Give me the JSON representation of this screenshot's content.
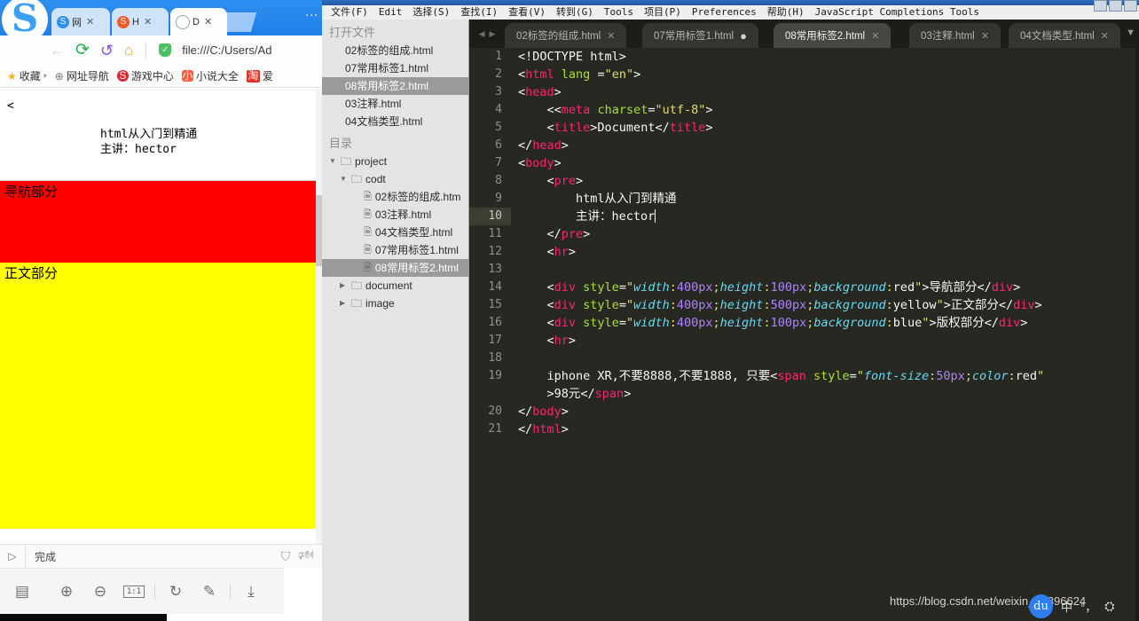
{
  "browser": {
    "logo": "S",
    "tabs": [
      {
        "label": "网",
        "favicon": "sogou-icon",
        "close": "✕",
        "active": false
      },
      {
        "label": "H",
        "favicon": "sogou-orange-icon",
        "close": "✕",
        "active": false
      },
      {
        "label": "D",
        "favicon": "document-icon",
        "close": "✕",
        "active": true
      }
    ],
    "nav": {
      "back": "←",
      "reload": "⟳",
      "undo": "↺",
      "home": "⌂",
      "shield": "✓",
      "url": "file:///C:/Users/Ad"
    },
    "bookmarks": [
      {
        "label": "收藏",
        "icon": "star-icon",
        "caret": "▾"
      },
      {
        "label": "网址导航",
        "icon": "globe-icon"
      },
      {
        "label": "游戏中心",
        "icon": "sogou-game-icon"
      },
      {
        "label": "小说大全",
        "icon": "novel-icon"
      },
      {
        "label": "爱",
        "icon": "taobao-icon"
      }
    ],
    "page": {
      "stray_text": "<",
      "pre_line1": "html从入门到精通",
      "pre_line2": "主讲：hector",
      "nav_section": "导航部分",
      "body_section": "正文部分"
    },
    "status": {
      "play": "▷",
      "text": "完成",
      "shield_icon": "shield-check-icon",
      "sound_icon": "speaker-icon"
    },
    "toolbar": {
      "layout": "▤",
      "zoom_in": "⊕",
      "zoom_out": "⊖",
      "ratio": "1:1",
      "rotate": "↻",
      "pen": "✎",
      "download": "⤓"
    }
  },
  "editor": {
    "menubar": [
      "文件(F)",
      "Edit",
      "选择(S)",
      "查找(I)",
      "查看(V)",
      "转到(G)",
      "Tools",
      "项目(P)",
      "Preferences",
      "帮助(H)",
      "JavaScript Completions Tools"
    ],
    "tabs": [
      {
        "label": "02标签的组成.html",
        "marker": "✕",
        "active": false
      },
      {
        "label": "07常用标签1.html",
        "marker": "●",
        "active": false
      },
      {
        "label": "08常用标签2.html",
        "marker": "✕",
        "active": true
      },
      {
        "label": "03注释.html",
        "marker": "✕",
        "active": false
      },
      {
        "label": "04文档类型.html",
        "marker": "✕",
        "active": false
      }
    ],
    "tab_arrow_left": "◀",
    "tab_arrow_right": "▶",
    "tab_menu": "▼",
    "current_line": 10,
    "lines": [
      {
        "n": "1",
        "tokens": [
          {
            "t": "punc",
            "v": "<!DOCTYPE html>"
          }
        ]
      },
      {
        "n": "2",
        "tokens": [
          {
            "t": "punc",
            "v": "<"
          },
          {
            "t": "tag",
            "v": "html"
          },
          {
            "t": "punc",
            "v": " "
          },
          {
            "t": "attr",
            "v": "lang"
          },
          {
            "t": "punc",
            "v": " ="
          },
          {
            "t": "str",
            "v": "\"en\""
          },
          {
            "t": "punc",
            "v": ">"
          }
        ]
      },
      {
        "n": "3",
        "tokens": [
          {
            "t": "punc",
            "v": "<"
          },
          {
            "t": "tag",
            "v": "head"
          },
          {
            "t": "punc",
            "v": ">"
          }
        ]
      },
      {
        "n": "4",
        "tokens": [
          {
            "t": "punc",
            "v": "    <<"
          },
          {
            "t": "tag",
            "v": "meta"
          },
          {
            "t": "punc",
            "v": " "
          },
          {
            "t": "attr",
            "v": "charset"
          },
          {
            "t": "punc",
            "v": "="
          },
          {
            "t": "str",
            "v": "\"utf-8\""
          },
          {
            "t": "punc",
            "v": ">"
          }
        ]
      },
      {
        "n": "5",
        "tokens": [
          {
            "t": "punc",
            "v": "    <"
          },
          {
            "t": "tag",
            "v": "title"
          },
          {
            "t": "punc",
            "v": ">"
          },
          {
            "t": "txt",
            "v": "Document"
          },
          {
            "t": "punc",
            "v": "</"
          },
          {
            "t": "tag",
            "v": "title"
          },
          {
            "t": "punc",
            "v": ">"
          }
        ]
      },
      {
        "n": "6",
        "tokens": [
          {
            "t": "punc",
            "v": "</"
          },
          {
            "t": "tag",
            "v": "head"
          },
          {
            "t": "punc",
            "v": ">"
          }
        ]
      },
      {
        "n": "7",
        "tokens": [
          {
            "t": "punc",
            "v": "<"
          },
          {
            "t": "tag",
            "v": "body"
          },
          {
            "t": "punc",
            "v": ">"
          }
        ]
      },
      {
        "n": "8",
        "tokens": [
          {
            "t": "punc",
            "v": "    <"
          },
          {
            "t": "tag",
            "v": "pre"
          },
          {
            "t": "punc",
            "v": ">"
          }
        ]
      },
      {
        "n": "9",
        "tokens": [
          {
            "t": "txt",
            "v": "        html从入门到精通"
          }
        ]
      },
      {
        "n": "10",
        "tokens": [
          {
            "t": "txt",
            "v": "        主讲：hector"
          }
        ],
        "caret": true
      },
      {
        "n": "11",
        "tokens": [
          {
            "t": "punc",
            "v": "    </"
          },
          {
            "t": "tag",
            "v": "pre"
          },
          {
            "t": "punc",
            "v": ">"
          }
        ]
      },
      {
        "n": "12",
        "tokens": [
          {
            "t": "punc",
            "v": "    <"
          },
          {
            "t": "tag",
            "v": "hr"
          },
          {
            "t": "punc",
            "v": ">"
          }
        ]
      },
      {
        "n": "13",
        "tokens": [
          {
            "t": "txt",
            "v": ""
          }
        ]
      },
      {
        "n": "14",
        "tokens": [
          {
            "t": "punc",
            "v": "    <"
          },
          {
            "t": "tag",
            "v": "div"
          },
          {
            "t": "punc",
            "v": " "
          },
          {
            "t": "attr",
            "v": "style"
          },
          {
            "t": "punc",
            "v": "="
          },
          {
            "t": "str",
            "v": "\""
          },
          {
            "t": "prop",
            "v": "width"
          },
          {
            "t": "str",
            "v": ":"
          },
          {
            "t": "num",
            "v": "400px"
          },
          {
            "t": "str",
            "v": ";"
          },
          {
            "t": "prop",
            "v": "height"
          },
          {
            "t": "str",
            "v": ":"
          },
          {
            "t": "num",
            "v": "100px"
          },
          {
            "t": "str",
            "v": ";"
          },
          {
            "t": "prop",
            "v": "background"
          },
          {
            "t": "str",
            "v": ":"
          },
          {
            "t": "val",
            "v": "red"
          },
          {
            "t": "str",
            "v": "\""
          },
          {
            "t": "punc",
            "v": ">"
          },
          {
            "t": "txt",
            "v": "导航部分"
          },
          {
            "t": "punc",
            "v": "</"
          },
          {
            "t": "tag",
            "v": "div"
          },
          {
            "t": "punc",
            "v": ">"
          }
        ]
      },
      {
        "n": "15",
        "tokens": [
          {
            "t": "punc",
            "v": "    <"
          },
          {
            "t": "tag",
            "v": "div"
          },
          {
            "t": "punc",
            "v": " "
          },
          {
            "t": "attr",
            "v": "style"
          },
          {
            "t": "punc",
            "v": "="
          },
          {
            "t": "str",
            "v": "\""
          },
          {
            "t": "prop",
            "v": "width"
          },
          {
            "t": "str",
            "v": ":"
          },
          {
            "t": "num",
            "v": "400px"
          },
          {
            "t": "str",
            "v": ";"
          },
          {
            "t": "prop",
            "v": "height"
          },
          {
            "t": "str",
            "v": ":"
          },
          {
            "t": "num",
            "v": "500px"
          },
          {
            "t": "str",
            "v": ";"
          },
          {
            "t": "prop",
            "v": "background"
          },
          {
            "t": "str",
            "v": ":"
          },
          {
            "t": "val",
            "v": "yellow"
          },
          {
            "t": "str",
            "v": "\""
          },
          {
            "t": "punc",
            "v": ">"
          },
          {
            "t": "txt",
            "v": "正文部分"
          },
          {
            "t": "punc",
            "v": "</"
          },
          {
            "t": "tag",
            "v": "div"
          },
          {
            "t": "punc",
            "v": ">"
          }
        ]
      },
      {
        "n": "16",
        "tokens": [
          {
            "t": "punc",
            "v": "    <"
          },
          {
            "t": "tag",
            "v": "div"
          },
          {
            "t": "punc",
            "v": " "
          },
          {
            "t": "attr",
            "v": "style"
          },
          {
            "t": "punc",
            "v": "="
          },
          {
            "t": "str",
            "v": "\""
          },
          {
            "t": "prop",
            "v": "width"
          },
          {
            "t": "str",
            "v": ":"
          },
          {
            "t": "num",
            "v": "400px"
          },
          {
            "t": "str",
            "v": ";"
          },
          {
            "t": "prop",
            "v": "height"
          },
          {
            "t": "str",
            "v": ":"
          },
          {
            "t": "num",
            "v": "100px"
          },
          {
            "t": "str",
            "v": ";"
          },
          {
            "t": "prop",
            "v": "background"
          },
          {
            "t": "str",
            "v": ":"
          },
          {
            "t": "val",
            "v": "blue"
          },
          {
            "t": "str",
            "v": "\""
          },
          {
            "t": "punc",
            "v": ">"
          },
          {
            "t": "txt",
            "v": "版权部分"
          },
          {
            "t": "punc",
            "v": "</"
          },
          {
            "t": "tag",
            "v": "div"
          },
          {
            "t": "punc",
            "v": ">"
          }
        ]
      },
      {
        "n": "17",
        "tokens": [
          {
            "t": "punc",
            "v": "    <"
          },
          {
            "t": "tag",
            "v": "hr"
          },
          {
            "t": "punc",
            "v": ">"
          }
        ]
      },
      {
        "n": "18",
        "tokens": [
          {
            "t": "txt",
            "v": ""
          }
        ]
      },
      {
        "n": "19",
        "tokens": [
          {
            "t": "txt",
            "v": "    iphone XR,不要8888,不要1888, 只要"
          },
          {
            "t": "punc",
            "v": "<"
          },
          {
            "t": "tag",
            "v": "span"
          },
          {
            "t": "punc",
            "v": " "
          },
          {
            "t": "attr",
            "v": "style"
          },
          {
            "t": "punc",
            "v": "="
          },
          {
            "t": "str",
            "v": "\""
          },
          {
            "t": "prop",
            "v": "font-size"
          },
          {
            "t": "str",
            "v": ":"
          },
          {
            "t": "num",
            "v": "50px"
          },
          {
            "t": "str",
            "v": ";"
          },
          {
            "t": "prop",
            "v": "color"
          },
          {
            "t": "str",
            "v": ":"
          },
          {
            "t": "val",
            "v": "red"
          },
          {
            "t": "str",
            "v": "\""
          }
        ],
        "wrap": [
          {
            "t": "punc",
            "v": "    >"
          },
          {
            "t": "txt",
            "v": "98元"
          },
          {
            "t": "punc",
            "v": "</"
          },
          {
            "t": "tag",
            "v": "span"
          },
          {
            "t": "punc",
            "v": ">"
          }
        ]
      },
      {
        "n": "20",
        "tokens": [
          {
            "t": "punc",
            "v": "</"
          },
          {
            "t": "tag",
            "v": "body"
          },
          {
            "t": "punc",
            "v": ">"
          }
        ]
      },
      {
        "n": "21",
        "tokens": [
          {
            "t": "punc",
            "v": "</"
          },
          {
            "t": "tag",
            "v": "html"
          },
          {
            "t": "punc",
            "v": ">"
          }
        ]
      }
    ]
  },
  "sidebar": {
    "open_files_heading": "打开文件",
    "open_files": [
      {
        "label": "02标签的组成.html",
        "selected": false
      },
      {
        "label": "07常用标签1.html",
        "selected": false
      },
      {
        "label": "08常用标签2.html",
        "selected": true
      },
      {
        "label": "03注释.html",
        "selected": false
      },
      {
        "label": "04文档类型.html",
        "selected": false
      }
    ],
    "folders_heading": "目录",
    "tree": [
      {
        "label": "project",
        "type": "folder",
        "arrow": "▼",
        "indent": 0,
        "selected": false
      },
      {
        "label": "codt",
        "type": "folder",
        "arrow": "▼",
        "indent": 1,
        "selected": false
      },
      {
        "label": "02标签的组成.htm",
        "type": "file",
        "arrow": "",
        "indent": 2,
        "selected": false
      },
      {
        "label": "03注释.html",
        "type": "file",
        "arrow": "",
        "indent": 2,
        "selected": false
      },
      {
        "label": "04文档类型.html",
        "type": "file",
        "arrow": "",
        "indent": 2,
        "selected": false
      },
      {
        "label": "07常用标签1.html",
        "type": "file",
        "arrow": "",
        "indent": 2,
        "selected": false
      },
      {
        "label": "08常用标签2.html",
        "type": "file",
        "arrow": "",
        "indent": 2,
        "selected": true
      },
      {
        "label": "document",
        "type": "folder",
        "arrow": "▶",
        "indent": 1,
        "selected": false
      },
      {
        "label": "image",
        "type": "folder",
        "arrow": "▶",
        "indent": 1,
        "selected": false
      }
    ]
  },
  "watermark": {
    "text": "https://blog.csdn.net/weixin_46396624"
  },
  "ime": {
    "logo": "du",
    "lang": "中",
    "punct": "°，",
    "tools": "⛭"
  },
  "colors": {
    "editor_bg": "#272822",
    "tag": "#f92672",
    "attr": "#a6e22e",
    "string": "#e6db74",
    "property": "#66d9ef",
    "number": "#ae81ff",
    "nav_block": "#ff0000",
    "body_block": "#ffff00",
    "browser_accent": "#2f8ef0"
  }
}
